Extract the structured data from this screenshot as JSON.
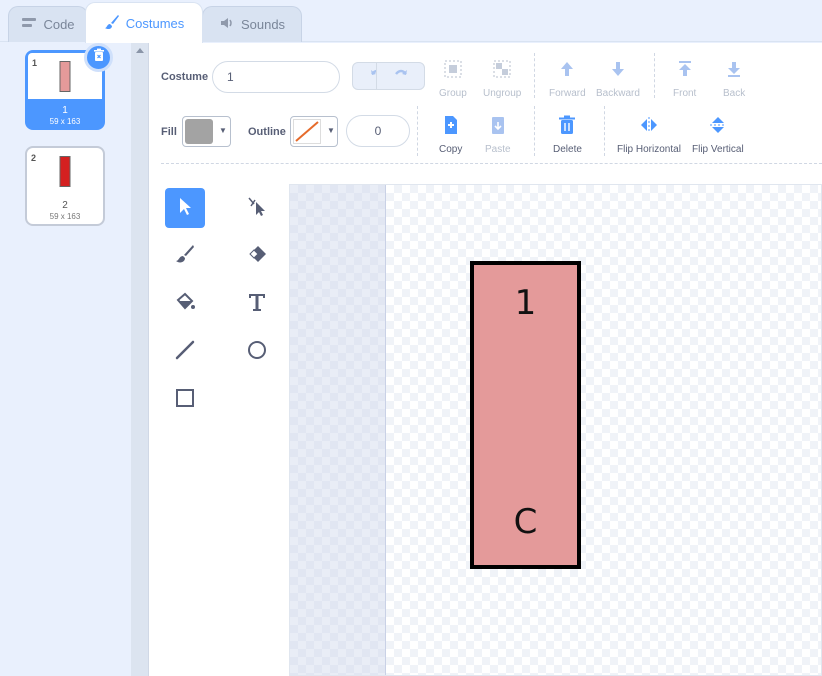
{
  "tabs": [
    {
      "label": "Code",
      "icon": "code-icon"
    },
    {
      "label": "Costumes",
      "icon": "brush-icon"
    },
    {
      "label": "Sounds",
      "icon": "speaker-icon"
    }
  ],
  "costumes": [
    {
      "num": "1",
      "name": "1",
      "size": "59 x 163",
      "color": "#e49a9a",
      "selected": true
    },
    {
      "num": "2",
      "name": "2",
      "size": "59 x 163",
      "color": "#d42020",
      "selected": false
    }
  ],
  "editor": {
    "costume_label": "Costume",
    "costume_name": "1",
    "fill_label": "Fill",
    "fill_color": "#a3a3a3",
    "outline_label": "Outline",
    "outline_width": "0",
    "buttons": {
      "group": "Group",
      "ungroup": "Ungroup",
      "forward": "Forward",
      "backward": "Backward",
      "front": "Front",
      "back": "Back",
      "copy": "Copy",
      "paste": "Paste",
      "delete": "Delete",
      "flip_horizontal": "Flip Horizontal",
      "flip_vertical": "Flip Vertical"
    }
  },
  "tools": [
    "select",
    "reshape",
    "brush",
    "eraser",
    "fill",
    "text",
    "line",
    "circle",
    "rectangle"
  ],
  "canvas": {
    "text_top": "1",
    "text_bottom": "C",
    "rect_fill": "#e49a9a",
    "rect_outline": "#000000"
  },
  "colors": {
    "accent": "#4c97ff",
    "background": "#e9f0fd"
  }
}
